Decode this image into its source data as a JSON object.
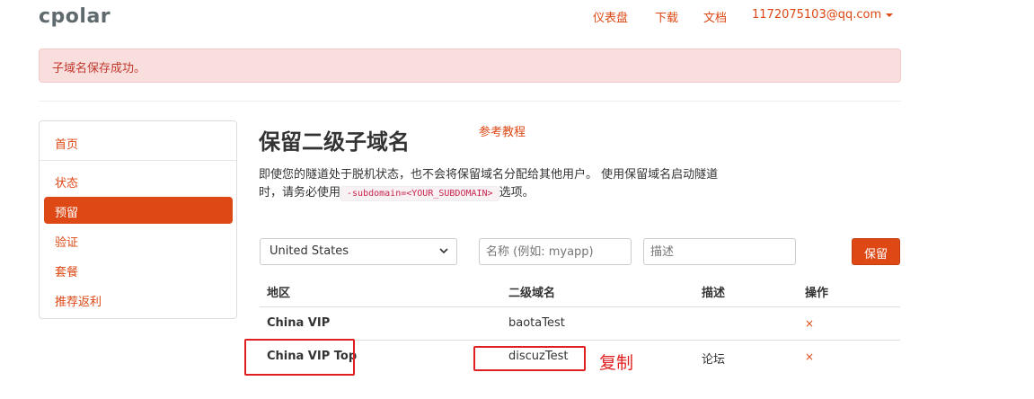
{
  "brand": {
    "logo": "cpolar"
  },
  "topnav": {
    "dashboard": "仪表盘",
    "download": "下载",
    "docs": "文档",
    "user": "1172075103@qq.com"
  },
  "alert": {
    "text": "子域名保存成功。"
  },
  "sidebar": {
    "items": [
      {
        "label": "首页"
      },
      {
        "label": "状态"
      },
      {
        "label": "预留",
        "active": true
      },
      {
        "label": "验证"
      },
      {
        "label": "套餐"
      },
      {
        "label": "推荐返利"
      }
    ]
  },
  "main": {
    "title": "保留二级子域名",
    "ref_link": "参考教程",
    "desc_line1": "即使您的隧道处于脱机状态，也不会将保留域名分配给其他用户。 使用保留域名启动隧道",
    "desc_line2_prefix": "时，请务必使用",
    "desc_flag": "-subdomain=<YOUR_SUBDOMAIN>",
    "desc_line2_suffix": "选项。"
  },
  "form": {
    "region_selected": "United States",
    "name_placeholder": "名称 (例如: myapp)",
    "desc_placeholder": "描述",
    "save_label": "保留"
  },
  "table": {
    "headers": [
      "地区",
      "二级域名",
      "描述",
      "操作"
    ],
    "rows": [
      {
        "region": "China VIP",
        "subdomain": "baotaTest",
        "desc": "",
        "action": "×"
      },
      {
        "region": "China VIP Top",
        "subdomain": "discuzTest",
        "desc": "论坛",
        "action": "×"
      }
    ]
  },
  "annotation": {
    "text": "复制"
  },
  "colors": {
    "accent": "#dd4814",
    "annotation": "#e02020",
    "alert_bg": "#f9dede"
  }
}
